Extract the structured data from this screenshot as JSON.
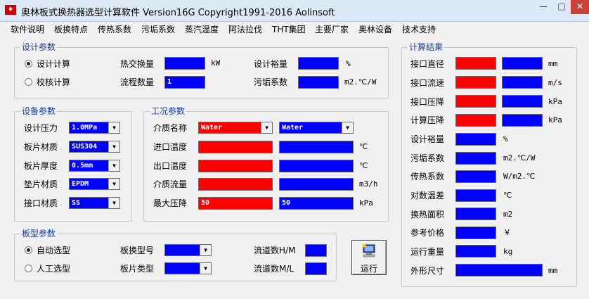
{
  "window": {
    "title": "奥林板式换热器选型计算软件  Version16G  Copyright1991-2016  Aolinsoft",
    "icon": "app-icon",
    "controls": {
      "minimize": "—",
      "maximize": "□",
      "close": "✕"
    }
  },
  "menu": [
    "软件说明",
    "板换特点",
    "传热系数",
    "污垢系数",
    "蒸汽温度",
    "阿法拉伐",
    "THT集团",
    "主要厂家",
    "奥林设备",
    "技术支持"
  ],
  "design": {
    "title": "设计参数",
    "radio_calc": "设计计算",
    "radio_check": "校核计算",
    "heat_label": "热交换量",
    "heat_unit": "kW",
    "flows_label": "流程数量",
    "flows_value": "1",
    "margin_label": "设计裕量",
    "margin_unit": "%",
    "foul_label": "污垢系数",
    "foul_unit": "m2.℃/W"
  },
  "equipment": {
    "title": "设备参数",
    "rows": [
      {
        "label": "设计压力",
        "value": "1.0MPa"
      },
      {
        "label": "板片材质",
        "value": "SUS304"
      },
      {
        "label": "板片厚度",
        "value": "0.5mm"
      },
      {
        "label": "垫片材质",
        "value": "EPDM"
      },
      {
        "label": "接口材质",
        "value": "SS"
      }
    ]
  },
  "conditions": {
    "title": "工况参数",
    "medium_label": "介质名称",
    "medium_hot": "Water",
    "medium_cold": "Water",
    "inlet_label": "进口温度",
    "inlet_unit": "℃",
    "outlet_label": "出口温度",
    "outlet_unit": "℃",
    "flow_label": "介质流量",
    "flow_unit": "m3/h",
    "pdrop_label": "最大压降",
    "pdrop_hot": "50",
    "pdrop_cold": "50",
    "pdrop_unit": "kPa"
  },
  "plate": {
    "title": "板型参数",
    "radio_auto": "自动选型",
    "radio_manual": "人工选型",
    "model_label": "板换型号",
    "type_label": "板片类型",
    "hm_label": "流道数H/M",
    "ml_label": "流道数M/L"
  },
  "run": {
    "label": "运行"
  },
  "results": {
    "title": "计算结果",
    "rows": [
      {
        "label": "接口直径",
        "unit": "mm"
      },
      {
        "label": "接口流速",
        "unit": "m/s"
      },
      {
        "label": "接口压降",
        "unit": "kPa"
      },
      {
        "label": "计算压降",
        "unit": "kPa"
      },
      {
        "label": "设计裕量",
        "unit": "%"
      },
      {
        "label": "污垢系数",
        "unit": "m2.℃/W"
      },
      {
        "label": "传热系数",
        "unit": "W/m2.℃"
      },
      {
        "label": "对数温差",
        "unit": "℃"
      },
      {
        "label": "换热面积",
        "unit": "m2"
      },
      {
        "label": "参考价格",
        "unit": "￥"
      },
      {
        "label": "运行重量",
        "unit": "kg"
      },
      {
        "label": "外形尺寸",
        "unit": "mm"
      }
    ]
  },
  "colors": {
    "hot": "#ff0000",
    "cold": "#0000ff",
    "group_title": "#1a3d9a"
  }
}
